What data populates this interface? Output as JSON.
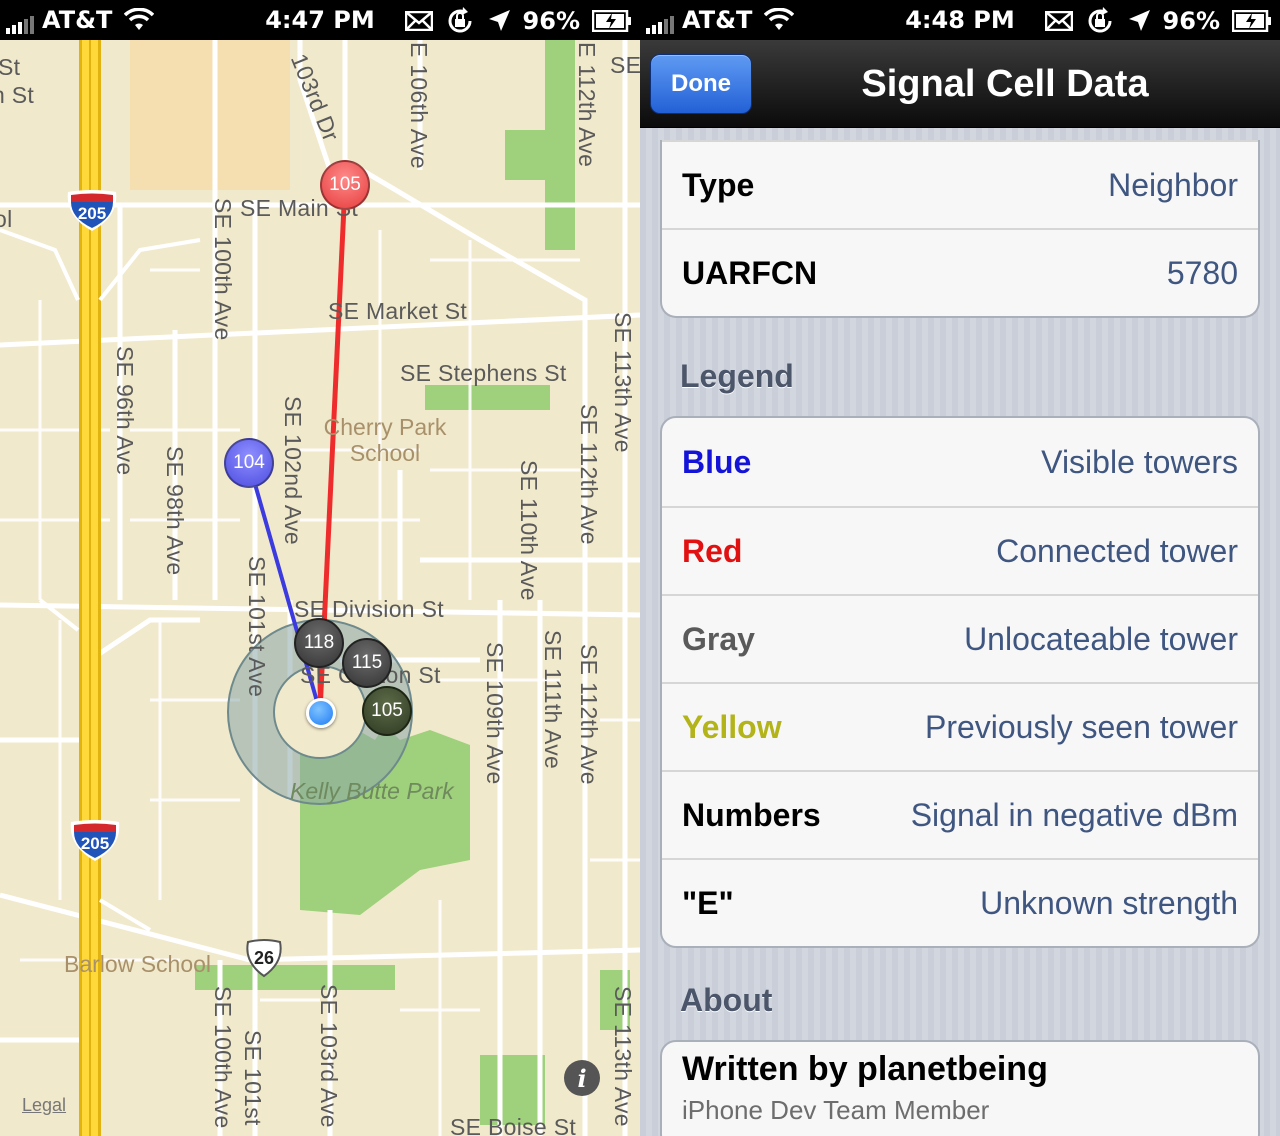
{
  "status_left": {
    "carrier": "AT&T",
    "time": "4:47 PM",
    "battery": "96%"
  },
  "status_right": {
    "carrier": "AT&T",
    "time": "4:48 PM",
    "battery": "96%"
  },
  "map": {
    "streets": {
      "st_top": "St",
      "n_st": "n St",
      "ol": "ol",
      "se_main": "SE Main St",
      "se_103rd_dr": "103rd Dr",
      "se_106th": "E 106th Ave",
      "se_112th_top": "E 112th Ave",
      "se_top_right": "SE",
      "se_100th": "SE 100th Ave",
      "se_market": "SE Market St",
      "se_stephens": "SE Stephens St",
      "se_113th": "SE 113th Ave",
      "se_96th": "SE 96th Ave",
      "se_98th": "SE 98th Ave",
      "se_102nd": "SE 102nd Ave",
      "se_112th_mid": "SE 112th Ave",
      "se_110th": "SE 110th Ave",
      "se_101st": "SE 101st Ave",
      "se_division": "SE Division St",
      "se_clinton": "SE Clinton St",
      "se_109th": "SE 109th Ave",
      "se_111th": "SE 111th Ave",
      "se_112th_low": "SE 112th Ave",
      "se_100th_bottom": "SE 100th Ave",
      "se_101st_bottom": "SE 101st",
      "se_103rd_bottom": "SE 103rd Ave",
      "se_113th_bottom": "SE 113th Ave",
      "se_boise": "SE Boise St"
    },
    "pois": {
      "cherry_park_1": "Cherry Park",
      "cherry_park_2": "School",
      "kelly_butte": "Kelly Butte Park",
      "barlow": "Barlow School"
    },
    "shields": {
      "i205_top": "205",
      "i205_bottom": "205",
      "us26": "26"
    },
    "markers": {
      "red": "105",
      "blue": "104",
      "gray1": "118",
      "gray2": "115",
      "green": "105"
    },
    "legal": "Legal",
    "info_icon": "i",
    "colors": {
      "connected_line": "#ee2c2c",
      "visible_line": "#3b3be0",
      "user_dot": "#1e7cf5"
    }
  },
  "panel": {
    "done_label": "Done",
    "title": "Signal Cell Data",
    "info_rows": [
      {
        "key": "Type",
        "value": "Neighbor"
      },
      {
        "key": "UARFCN",
        "value": "5780"
      }
    ],
    "legend_header": "Legend",
    "legend_rows": [
      {
        "key": "Blue",
        "value": "Visible towers",
        "color": "#1414d8"
      },
      {
        "key": "Red",
        "value": "Connected tower",
        "color": "#e21111"
      },
      {
        "key": "Gray",
        "value": "Unlocateable tower",
        "color": "#5a5a5a"
      },
      {
        "key": "Yellow",
        "value": "Previously seen tower",
        "color": "#b3b31a"
      },
      {
        "key": "Numbers",
        "value": "Signal in negative dBm",
        "color": "#000000"
      },
      {
        "key": "\"E\"",
        "value": "Unknown strength",
        "color": "#000000"
      }
    ],
    "about_header": "About",
    "about_title": "Written by planetbeing",
    "about_subtitle": "iPhone Dev Team Member"
  }
}
